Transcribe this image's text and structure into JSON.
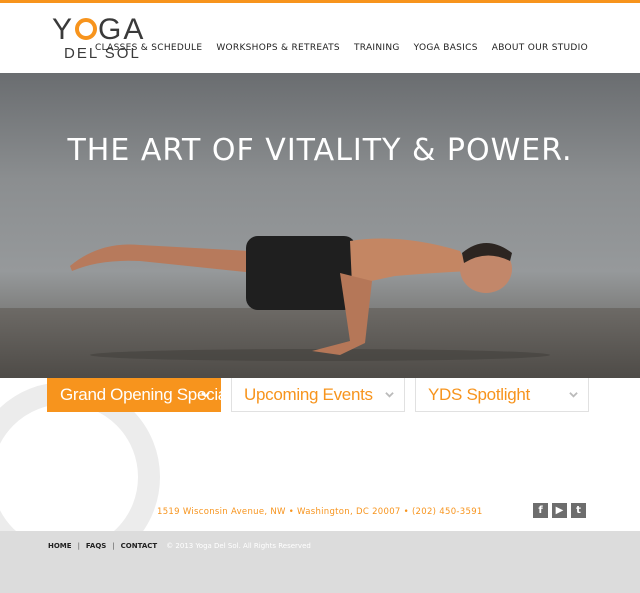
{
  "brand": {
    "logo_top": "YOGA",
    "logo_bottom": "DEL SOL",
    "accent": "#f7941d"
  },
  "nav": {
    "items": [
      "CLASSES & SCHEDULE",
      "WORKSHOPS & RETREATS",
      "TRAINING",
      "YOGA BASICS",
      "ABOUT OUR STUDIO"
    ]
  },
  "hero": {
    "headline": "THE ART OF VITALITY & POWER."
  },
  "tabs": [
    {
      "label": "Grand Opening Special",
      "active": true,
      "icon": "chevron-down-icon"
    },
    {
      "label": "Upcoming Events",
      "active": false,
      "icon": "chevron-down-icon"
    },
    {
      "label": "YDS Spotlight",
      "active": false,
      "icon": "chevron-down-icon"
    }
  ],
  "contact": {
    "address": "1519 Wisconsin Avenue, NW • Washington, DC 20007 • (202) 450-3591"
  },
  "social": [
    {
      "name": "facebook-icon",
      "glyph": "f"
    },
    {
      "name": "youtube-icon",
      "glyph": "▶"
    },
    {
      "name": "twitter-icon",
      "glyph": "t"
    }
  ],
  "footer": {
    "links": [
      "HOME",
      "FAQS",
      "CONTACT"
    ],
    "separator": "|",
    "copyright": "© 2013 Yoga Del Sol. All Rights Reserved"
  }
}
